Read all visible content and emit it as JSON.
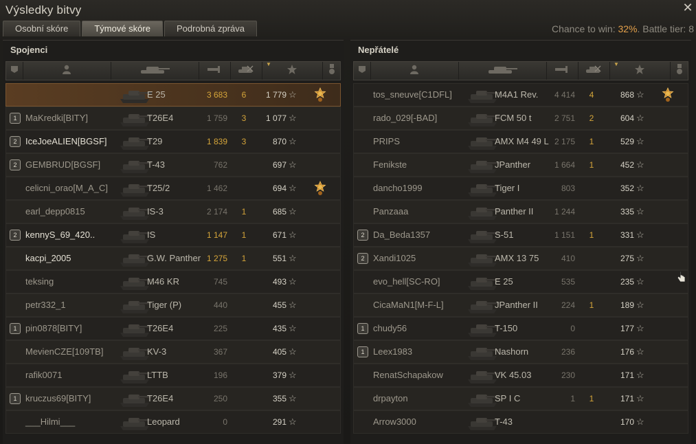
{
  "window": {
    "title": "Výsledky bitvy"
  },
  "tabs": [
    {
      "label": "Osobní skóre",
      "active": false
    },
    {
      "label": "Týmové skóre",
      "active": true
    },
    {
      "label": "Podrobná zpráva",
      "active": false
    }
  ],
  "chance": {
    "prefix": "Chance to win: ",
    "value": "32%",
    "suffix": ". Battle tier: 8"
  },
  "colors": {
    "accent_gold": "#d5a53a",
    "chance_orange": "#e3a04a",
    "self_row": "#5a3d22"
  },
  "header_icons": [
    "platoon-icon",
    "player-icon",
    "tank-icon",
    "damage-icon",
    "kills-icon",
    "xp-icon",
    "medal-icon"
  ],
  "allies": {
    "title": "Spojenci",
    "rows": [
      {
        "platoon": "",
        "name": "",
        "tank": "E 25",
        "damage": "3 683",
        "kills": "6",
        "xp": "1 779",
        "medal": true,
        "self": true,
        "gold_damage": true,
        "bright": true
      },
      {
        "platoon": "1",
        "name": "MaKredki[BITY]",
        "tank": "T26E4",
        "damage": "1 759",
        "kills": "3",
        "xp": "1 077",
        "medal": false
      },
      {
        "platoon": "2",
        "name": "IceJoeALIEN[BGSF]",
        "tank": "T29",
        "damage": "1 839",
        "kills": "3",
        "xp": "870",
        "medal": false,
        "gold_damage": true,
        "bright": true
      },
      {
        "platoon": "2",
        "name": "GEMBRUD[BGSF]",
        "tank": "T-43",
        "damage": "762",
        "kills": "",
        "xp": "697",
        "medal": false
      },
      {
        "platoon": "",
        "name": "celicni_orao[M_A_C]",
        "tank": "T25/2",
        "damage": "1 462",
        "kills": "",
        "xp": "694",
        "medal": true
      },
      {
        "platoon": "",
        "name": "earl_depp0815",
        "tank": "IS-3",
        "damage": "2 174",
        "kills": "1",
        "xp": "685",
        "medal": false
      },
      {
        "platoon": "2",
        "name": "kennyS_69_420..",
        "tank": "IS",
        "damage": "1 147",
        "kills": "1",
        "xp": "671",
        "medal": false,
        "gold_damage": true,
        "bright": true
      },
      {
        "platoon": "",
        "name": "kacpi_2005",
        "tank": "G.W. Panther",
        "damage": "1 275",
        "kills": "1",
        "xp": "551",
        "medal": false,
        "gold_damage": true,
        "bright": true
      },
      {
        "platoon": "",
        "name": "teksing",
        "tank": "M46 KR",
        "damage": "745",
        "kills": "",
        "xp": "493",
        "medal": false
      },
      {
        "platoon": "",
        "name": "petr332_1",
        "tank": "Tiger (P)",
        "damage": "440",
        "kills": "",
        "xp": "455",
        "medal": false
      },
      {
        "platoon": "1",
        "name": "pin0878[BITY]",
        "tank": "T26E4",
        "damage": "225",
        "kills": "",
        "xp": "435",
        "medal": false
      },
      {
        "platoon": "",
        "name": "MevienCZE[109TB]",
        "tank": "KV-3",
        "damage": "367",
        "kills": "",
        "xp": "405",
        "medal": false
      },
      {
        "platoon": "",
        "name": "rafik0071",
        "tank": "LTTB",
        "damage": "196",
        "kills": "",
        "xp": "379",
        "medal": false
      },
      {
        "platoon": "1",
        "name": "kruczus69[BITY]",
        "tank": "T26E4",
        "damage": "250",
        "kills": "",
        "xp": "355",
        "medal": false
      },
      {
        "platoon": "",
        "name": "___Hilmi___",
        "tank": "Leopard",
        "damage": "0",
        "kills": "",
        "xp": "291",
        "medal": false
      }
    ]
  },
  "enemies": {
    "title": "Nepřátelé",
    "rows": [
      {
        "platoon": "",
        "name": "tos_sneuve[C1DFL]",
        "tank": "M4A1 Rev.",
        "damage": "4 414",
        "kills": "4",
        "xp": "868",
        "medal": true
      },
      {
        "platoon": "",
        "name": "rado_029[-BAD]",
        "tank": "FCM 50 t",
        "damage": "2 751",
        "kills": "2",
        "xp": "604",
        "medal": false
      },
      {
        "platoon": "",
        "name": "PRIPS",
        "tank": "AMX M4 49 L",
        "damage": "2 175",
        "kills": "1",
        "xp": "529",
        "medal": false
      },
      {
        "platoon": "",
        "name": "Fenikste",
        "tank": "JPanther",
        "damage": "1 664",
        "kills": "1",
        "xp": "452",
        "medal": false
      },
      {
        "platoon": "",
        "name": "dancho1999",
        "tank": "Tiger I",
        "damage": "803",
        "kills": "",
        "xp": "352",
        "medal": false
      },
      {
        "platoon": "",
        "name": "Panzaaa",
        "tank": "Panther II",
        "damage": "1 244",
        "kills": "",
        "xp": "335",
        "medal": false
      },
      {
        "platoon": "2",
        "name": "Da_Beda1357",
        "tank": "S-51",
        "damage": "1 151",
        "kills": "1",
        "xp": "331",
        "medal": false
      },
      {
        "platoon": "2",
        "name": "Xandi1025",
        "tank": "AMX 13 75",
        "damage": "410",
        "kills": "",
        "xp": "275",
        "medal": false
      },
      {
        "platoon": "",
        "name": "evo_hell[SC-RO]",
        "tank": "E 25",
        "damage": "535",
        "kills": "",
        "xp": "235",
        "medal": false
      },
      {
        "platoon": "",
        "name": "CicaMaN1[M-F-L]",
        "tank": "JPanther II",
        "damage": "224",
        "kills": "1",
        "xp": "189",
        "medal": false
      },
      {
        "platoon": "1",
        "name": "chudy56",
        "tank": "T-150",
        "damage": "0",
        "kills": "",
        "xp": "177",
        "medal": false
      },
      {
        "platoon": "1",
        "name": "Leex1983",
        "tank": "Nashorn",
        "damage": "236",
        "kills": "",
        "xp": "176",
        "medal": false
      },
      {
        "platoon": "",
        "name": "RenatSchapakow",
        "tank": "VK 45.03",
        "damage": "230",
        "kills": "",
        "xp": "171",
        "medal": false
      },
      {
        "platoon": "",
        "name": "drpayton",
        "tank": "SP I C",
        "damage": "1",
        "kills": "1",
        "xp": "171",
        "medal": false
      },
      {
        "platoon": "",
        "name": "Arrow3000",
        "tank": "T-43",
        "damage": "",
        "kills": "",
        "xp": "170",
        "medal": false
      }
    ]
  }
}
